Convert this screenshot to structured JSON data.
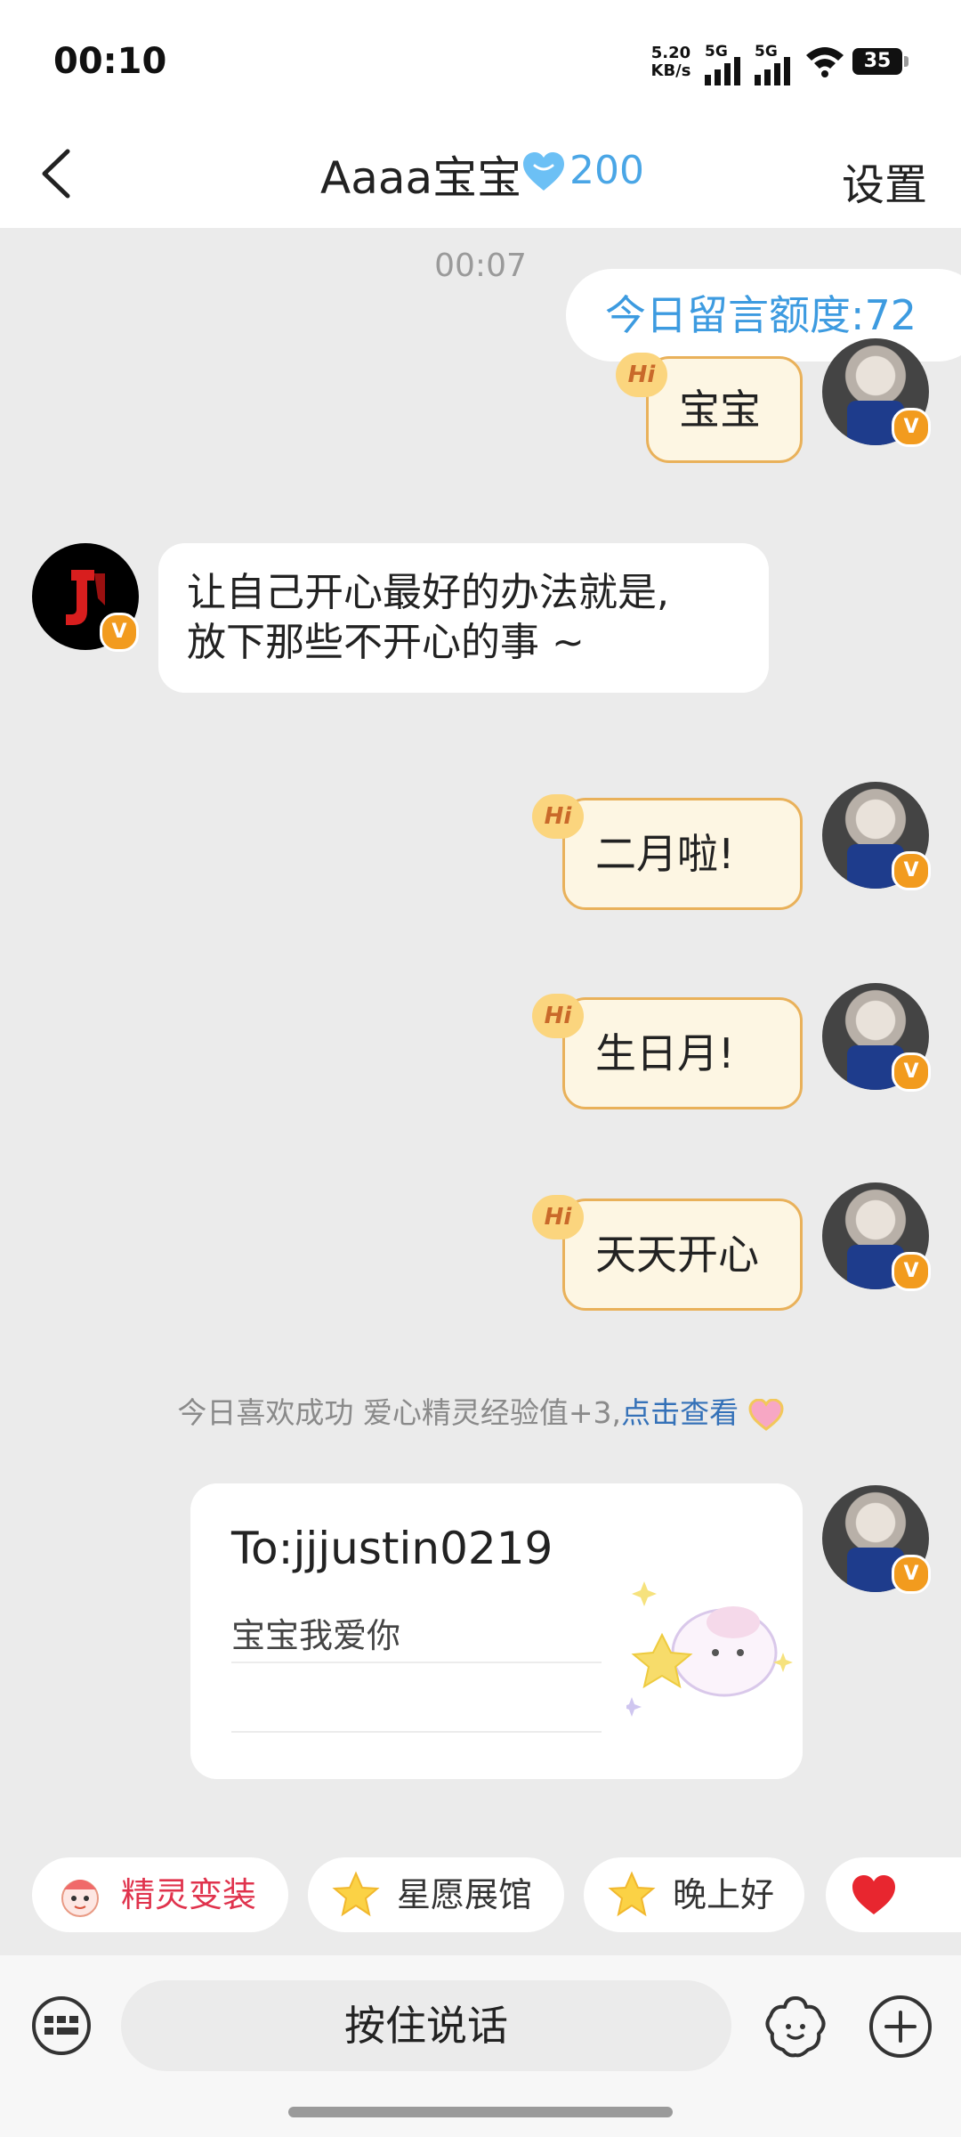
{
  "status_bar": {
    "time": "00:10",
    "net_speed_value": "5.20",
    "net_speed_unit": "KB/s",
    "sim1": "5G",
    "sim2": "5G",
    "battery": "35"
  },
  "header": {
    "title": "Aaaa宝宝",
    "heart_icon": "blue-heart-icon",
    "heart_count": "200",
    "settings_label": "设置"
  },
  "chat": {
    "timestamp": "00:07",
    "quota_label": "今日留言额度:72",
    "hi_badge": "Hi",
    "messages": [
      {
        "from": "me",
        "text": "宝宝"
      },
      {
        "from": "other",
        "text_line1": "让自己开心最好的办法就是,",
        "text_line2": "放下那些不开心的事 ~"
      },
      {
        "from": "me",
        "text": "二月啦!"
      },
      {
        "from": "me",
        "text": "生日月!"
      },
      {
        "from": "me",
        "text": "天天开心"
      }
    ],
    "system_notice": {
      "text": "今日喜欢成功 爱心精灵经验值+3,",
      "link": "点击查看"
    },
    "card": {
      "to": "To:jjjustin0219",
      "message": "宝宝我爱你"
    },
    "verified_badge": "V"
  },
  "quick_chips": [
    {
      "label": "精灵变装",
      "icon": "sprite-costume-icon",
      "color": "#e0334d"
    },
    {
      "label": "星愿展馆",
      "icon": "star-icon",
      "color": "#333333"
    },
    {
      "label": "晚上好",
      "icon": "star-icon",
      "color": "#333333"
    },
    {
      "label": "",
      "icon": "heart-icon",
      "color": "#333333"
    }
  ],
  "input_bar": {
    "hold_to_talk": "按住说话"
  },
  "colors": {
    "accent_blue": "#3d9be0",
    "bubble_me_fill": "#fdf6e3",
    "bubble_me_border": "#e9b15a",
    "badge_orange": "#f29b1e"
  }
}
